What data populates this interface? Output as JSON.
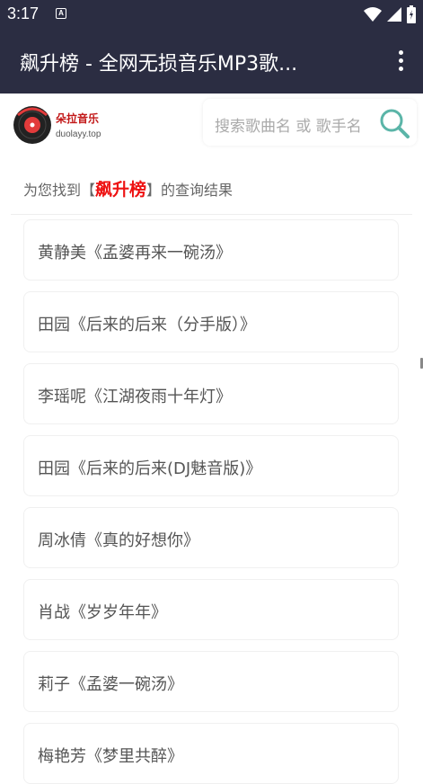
{
  "status_bar": {
    "time": "3:17",
    "notification_letter": "A",
    "icons": [
      "wifi-icon",
      "signal-icon",
      "battery-icon"
    ]
  },
  "app_bar": {
    "title": "飙升榜 - 全网无损音乐MP3歌...",
    "menu_icon": "more-vert-icon"
  },
  "logo": {
    "name": "朵拉音乐",
    "domain": "duolayy.top"
  },
  "search": {
    "placeholder": "搜索歌曲名 或 歌手名",
    "icon": "search-icon"
  },
  "result": {
    "prefix": "为您找到【",
    "keyword": "飙升榜",
    "suffix": "】的查询结果"
  },
  "songs": [
    "黄静美《孟婆再来一碗汤》",
    "田园《后来的后来（分手版）》",
    "李瑶呢《江湖夜雨十年灯》",
    "田园《后来的后来(DJ魅音版)》",
    "周冰倩《真的好想你》",
    "肖战《岁岁年年》",
    "莉子《孟婆一碗汤》",
    "梅艳芳《梦里共醉》"
  ],
  "colors": {
    "bar": "#2b2d42",
    "keyword": "#ee1111",
    "search_icon": "#5bb5a8"
  }
}
